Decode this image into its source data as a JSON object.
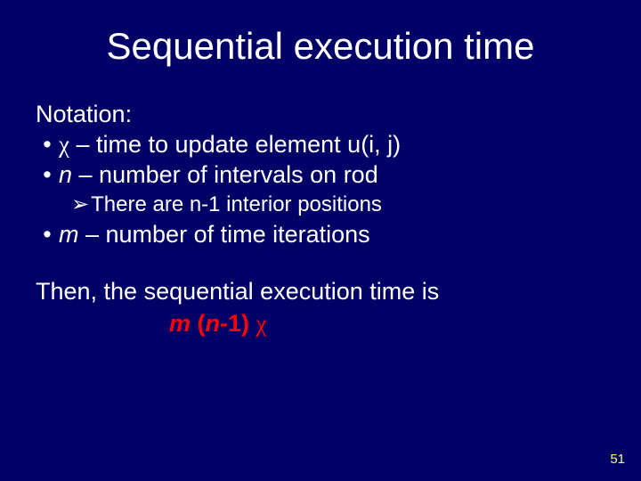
{
  "title": "Sequential execution time",
  "notation_label": "Notation:",
  "b1_chi": "χ",
  "b1_rest": " – time to update element u(i, j)",
  "b2_var": "n",
  "b2_rest": " – number of intervals on rod",
  "sub1": "There are n-1 interior positions",
  "b3_var": "m",
  "b3_rest": " – number of time iterations",
  "then_line": "Then, the sequential execution time is",
  "formula_m": "m ",
  "formula_paren": "(",
  "formula_n": "n",
  "formula_minus": "-1) ",
  "formula_chi": "χ",
  "page": "51"
}
